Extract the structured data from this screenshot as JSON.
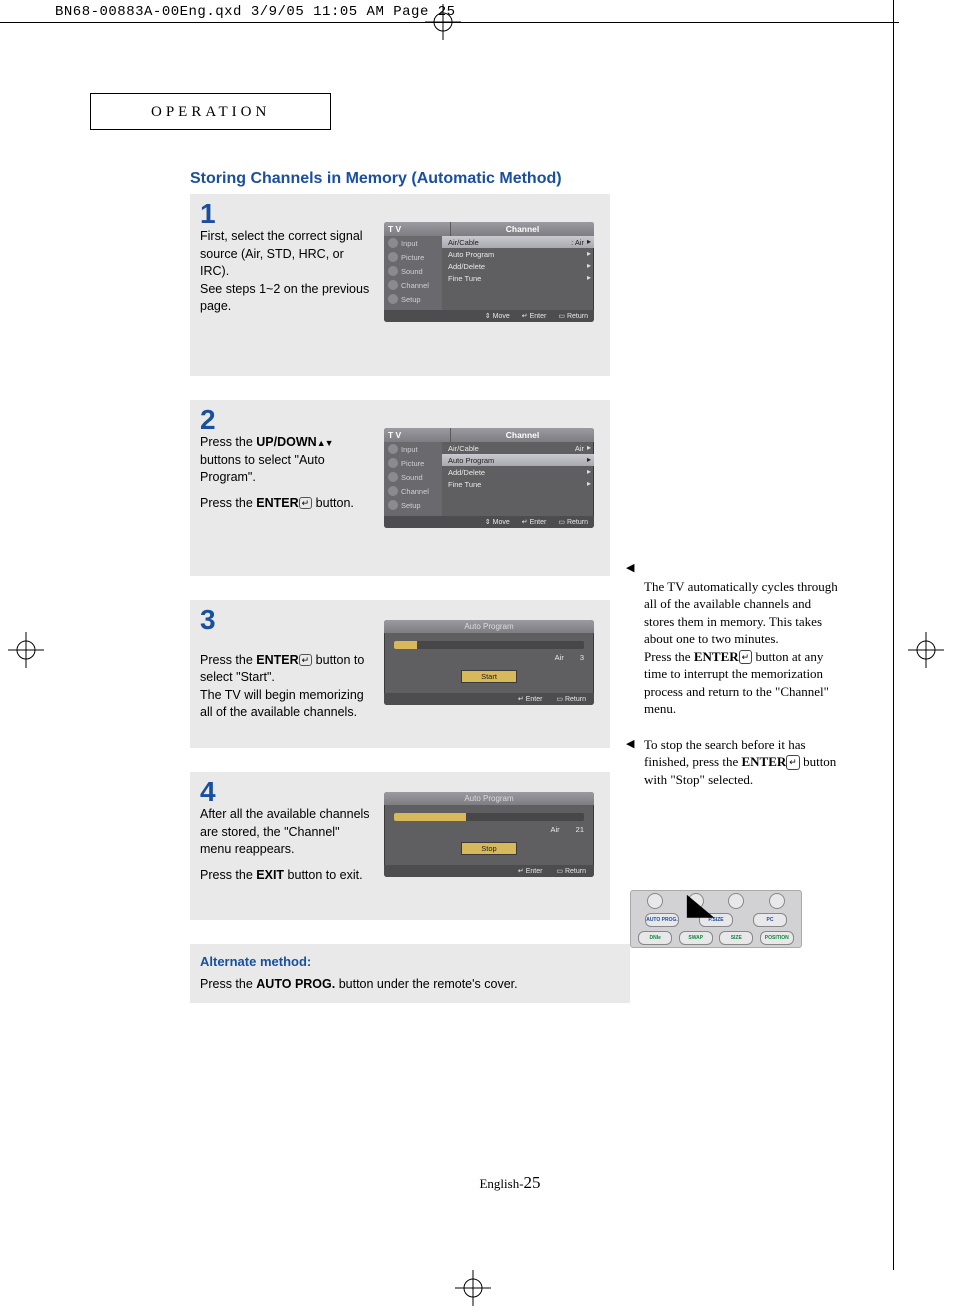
{
  "header_line": "BN68-00883A-00Eng.qxd  3/9/05 11:05 AM  Page 25",
  "section_tab": "OPERATION",
  "title": "Storing Channels in Memory (Automatic Method)",
  "steps": [
    {
      "num": "1",
      "text_pre": "First, select the correct signal source (Air, STD, HRC, or IRC).\nSee steps 1~2 on the previous page.",
      "osd": {
        "tv": "T V",
        "menu_title": "Channel",
        "nav": [
          "Input",
          "Picture",
          "Sound",
          "Channel",
          "Setup"
        ],
        "rows": [
          {
            "label": "Air/Cable",
            "value": ": Air",
            "sel": true
          },
          {
            "label": "Auto Program",
            "value": "",
            "sel": false
          },
          {
            "label": "Add/Delete",
            "value": "",
            "sel": false
          },
          {
            "label": "Fine Tune",
            "value": "",
            "sel": false
          }
        ],
        "footer": [
          "Move",
          "Enter",
          "Return"
        ],
        "footer_icons": [
          "⇕",
          "↵",
          "▭"
        ]
      }
    },
    {
      "num": "2",
      "text_pre": "Press the ",
      "bold1": "UP/DOWN",
      "after_bold1_sym": "▲▼",
      "text_mid": " buttons to select \"Auto Program\".",
      "text_line2_pre": "Press the ",
      "bold2": "ENTER",
      "text_line2_post": " button.",
      "osd": {
        "tv": "T V",
        "menu_title": "Channel",
        "nav": [
          "Input",
          "Picture",
          "Sound",
          "Channel",
          "Setup"
        ],
        "rows": [
          {
            "label": "Air/Cable",
            "value": "Air",
            "sel": false
          },
          {
            "label": "Auto Program",
            "value": "",
            "sel": true
          },
          {
            "label": "Add/Delete",
            "value": "",
            "sel": false
          },
          {
            "label": "Fine Tune",
            "value": "",
            "sel": false
          }
        ],
        "footer": [
          "Move",
          "Enter",
          "Return"
        ],
        "footer_icons": [
          "⇕",
          "↵",
          "▭"
        ]
      }
    },
    {
      "num": "3",
      "text_pre": "Press the ",
      "bold1": "ENTER",
      "text_post": " button to select \"Start\".\nThe TV will begin memorizing all of the available channels.",
      "prog": {
        "title": "Auto Program",
        "air_label": "Air",
        "air_value": "3",
        "button": "Start",
        "footer": [
          "Enter",
          "Return"
        ],
        "bar_pct": 12
      }
    },
    {
      "num": "4",
      "text_pre": "After all the available channels are stored, the \"Channel\" menu reappears.",
      "text_line2_pre": "Press the ",
      "bold2": "EXIT",
      "text_line2_post": " button to exit.",
      "prog": {
        "title": "Auto Program",
        "air_label": "Air",
        "air_value": "21",
        "button": "Stop",
        "footer": [
          "Enter",
          "Return"
        ],
        "bar_pct": 38
      }
    }
  ],
  "notes": [
    {
      "pre": "The TV automatically cycles through all of the available channels and stores them in memory. This takes about one to two minutes.\nPress the ",
      "bold": "ENTER",
      "post": " button at any time to interrupt the memorization process and return to the \"Channel\" menu."
    },
    {
      "pre": "To stop the search before it has finished, press the ",
      "bold": "ENTER",
      "post": " button with \"Stop\" selected."
    }
  ],
  "alternate": {
    "heading": "Alternate method:",
    "pre": "Press the ",
    "bold": "AUTO PROG.",
    "post": " button under the remote's cover."
  },
  "remote_labels": [
    "AUTO PROG.",
    "P.SIZE",
    "PC",
    "DNIe",
    "SWAP",
    "SIZE",
    "POSITION"
  ],
  "page_footer_pre": "English-",
  "page_footer_num": "25"
}
